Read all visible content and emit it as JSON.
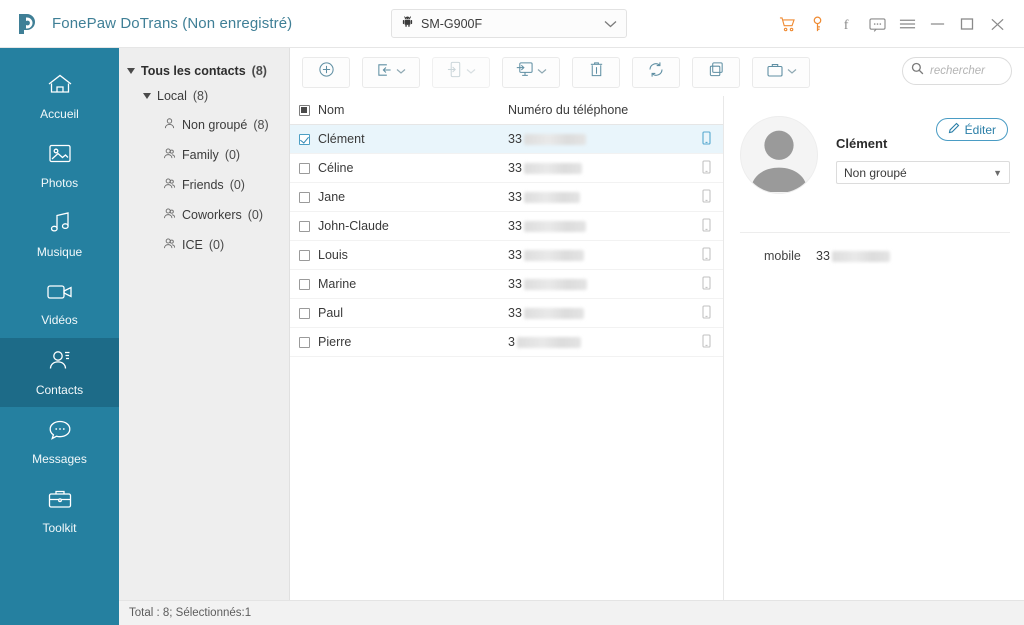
{
  "titlebar": {
    "logo": "fonepaw-logo",
    "app_title": "FonePaw DoTrans (Non enregistré)",
    "device": {
      "name": "SM-G900F",
      "icon": "android-robot-icon",
      "chevron": "chevron-down-icon"
    },
    "window_icons": [
      {
        "name": "cart-icon",
        "glyph": "cart",
        "color": "#ef8b33"
      },
      {
        "name": "key-icon",
        "glyph": "key",
        "color": "#ef8b33"
      },
      {
        "name": "facebook-icon",
        "glyph": "f",
        "color": "#8a8a8a"
      },
      {
        "name": "feedback-icon",
        "glyph": "chat",
        "color": "#8a8a8a"
      },
      {
        "name": "menu-icon",
        "glyph": "hamburger",
        "color": "#8a8a8a"
      },
      {
        "name": "minimize-icon",
        "glyph": "minimize",
        "color": "#8a8a8a"
      },
      {
        "name": "maximize-icon",
        "glyph": "maximize",
        "color": "#8a8a8a"
      },
      {
        "name": "close-icon",
        "glyph": "close",
        "color": "#8a8a8a"
      }
    ]
  },
  "sidebar": {
    "accent": "#2580a0",
    "active_bg": "#1d6b88",
    "items": [
      {
        "label": "Accueil",
        "icon": "home-icon",
        "active": false
      },
      {
        "label": "Photos",
        "icon": "photo-icon",
        "active": false
      },
      {
        "label": "Musique",
        "icon": "music-icon",
        "active": false
      },
      {
        "label": "Vidéos",
        "icon": "video-icon",
        "active": false
      },
      {
        "label": "Contacts",
        "icon": "contact-icon",
        "active": true
      },
      {
        "label": "Messages",
        "icon": "message-icon",
        "active": false
      },
      {
        "label": "Toolkit",
        "icon": "toolkit-icon",
        "active": false
      }
    ]
  },
  "tree": {
    "root": {
      "label": "Tous les contacts",
      "count": "(8)"
    },
    "local": {
      "label": "Local",
      "count": "(8)"
    },
    "groups": [
      {
        "label": "Non groupé",
        "count": "(8)"
      },
      {
        "label": "Family",
        "count": "(0)"
      },
      {
        "label": "Friends",
        "count": "(0)"
      },
      {
        "label": "Coworkers",
        "count": "(0)"
      },
      {
        "label": "ICE",
        "count": "(0)"
      }
    ]
  },
  "toolbar": {
    "buttons": [
      {
        "name": "add-contact-button",
        "icon": "plus-circle-icon",
        "caret": false,
        "disabled": false
      },
      {
        "name": "import-contacts-button",
        "icon": "import-icon",
        "caret": true,
        "disabled": false
      },
      {
        "name": "export-to-device-button",
        "icon": "export-phone-icon",
        "caret": true,
        "disabled": true
      },
      {
        "name": "export-to-computer-button",
        "icon": "export-pc-icon",
        "caret": true,
        "disabled": false
      },
      {
        "name": "delete-button",
        "icon": "trash-icon",
        "caret": false,
        "disabled": false
      },
      {
        "name": "refresh-button",
        "icon": "refresh-icon",
        "caret": false,
        "disabled": false
      },
      {
        "name": "deduplicate-button",
        "icon": "copy-icon",
        "caret": false,
        "disabled": false
      },
      {
        "name": "toolkit-button",
        "icon": "briefcase-icon",
        "caret": true,
        "disabled": false
      }
    ],
    "search": {
      "icon": "search-icon",
      "placeholder": "rechercher",
      "value": ""
    }
  },
  "table": {
    "select_all_state": "indeterminate",
    "columns": [
      {
        "key": "name",
        "label": "Nom",
        "sorted": "asc"
      },
      {
        "key": "phone",
        "label": "Numéro du téléphone",
        "sorted": "none"
      }
    ],
    "rows": [
      {
        "name": "Clément",
        "phone_prefix": "33",
        "phone_masked": true,
        "blur_width": 62,
        "checked": true,
        "selected": true,
        "type_icon": "mobile-icon"
      },
      {
        "name": "Céline",
        "phone_prefix": "33",
        "phone_masked": true,
        "blur_width": 58,
        "checked": false,
        "selected": false,
        "type_icon": "mobile-icon"
      },
      {
        "name": "Jane",
        "phone_prefix": "33",
        "phone_masked": true,
        "blur_width": 56,
        "checked": false,
        "selected": false,
        "type_icon": "mobile-icon"
      },
      {
        "name": "John-Claude",
        "phone_prefix": "33",
        "phone_masked": true,
        "blur_width": 62,
        "checked": false,
        "selected": false,
        "type_icon": "mobile-icon"
      },
      {
        "name": "Louis",
        "phone_prefix": "33",
        "phone_masked": true,
        "blur_width": 60,
        "checked": false,
        "selected": false,
        "type_icon": "mobile-icon"
      },
      {
        "name": "Marine",
        "phone_prefix": "33",
        "phone_masked": true,
        "blur_width": 63,
        "checked": false,
        "selected": false,
        "type_icon": "mobile-icon"
      },
      {
        "name": "Paul",
        "phone_prefix": "33",
        "phone_masked": true,
        "blur_width": 60,
        "checked": false,
        "selected": false,
        "type_icon": "mobile-icon"
      },
      {
        "name": "Pierre",
        "phone_prefix": "3",
        "phone_masked": true,
        "blur_width": 64,
        "checked": false,
        "selected": false,
        "type_icon": "mobile-icon"
      }
    ]
  },
  "detail": {
    "avatar": "default-avatar-icon",
    "edit_button": {
      "label": "Éditer",
      "icon": "pencil-icon"
    },
    "name": "Clément",
    "group": {
      "value": "Non groupé",
      "chevron": "chevron-down-icon"
    },
    "fields": [
      {
        "label": "mobile",
        "prefix": "33",
        "masked": true,
        "blur_width": 58
      }
    ]
  },
  "statusbar": {
    "text": "Total : 8; Sélectionnés:1"
  }
}
